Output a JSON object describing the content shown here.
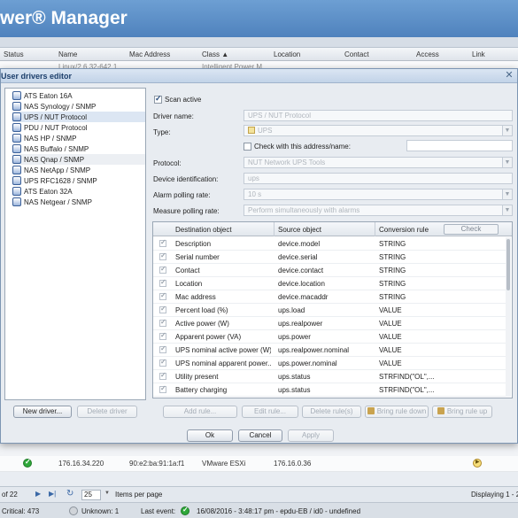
{
  "app": {
    "title": "wer® Manager"
  },
  "grid": {
    "columns": [
      "Status",
      "Name",
      "Mac Address",
      "Class ▲",
      "Location",
      "Contact",
      "Access",
      "Link"
    ],
    "top_row": {
      "name": "Linux/2.6.32-642.1",
      "class": "Intelligent Power M"
    },
    "rows": [
      {
        "ip": "176.16.34.220",
        "mac": "90:e2:ba:91:1a:f1",
        "class": "VMware ESXi",
        "location": "176.16.0.36"
      }
    ]
  },
  "pager": {
    "of_pages": "of 22",
    "page_size": "25",
    "items_label": "Items per page",
    "displaying": "Displaying 1 - 2"
  },
  "statusbar": {
    "critical": "Critical: 473",
    "unknown": "Unknown: 1",
    "last_event_label": "Last event:",
    "last_event": "16/08/2016 - 3:48:17 pm - epdu-EB / id0 - undefined"
  },
  "dialog": {
    "title": "User drivers editor",
    "drivers": [
      "ATS Eaton 16A",
      "NAS Synology / SNMP",
      "UPS / NUT Protocol",
      "PDU / NUT Protocol",
      "NAS HP / SNMP",
      "NAS Buffalo / SNMP",
      "NAS Qnap / SNMP",
      "NAS NetApp / SNMP",
      "UPS RFC1628 / SNMP",
      "ATS Eaton 32A",
      "NAS Netgear / SNMP"
    ],
    "selected_driver": "UPS / NUT Protocol",
    "form": {
      "scan_active_label": "Scan active",
      "driver_name_label": "Driver name:",
      "driver_name_value": "UPS / NUT Protocol",
      "type_label": "Type:",
      "type_value": "UPS",
      "check_address_label": "Check with this address/name:",
      "protocol_label": "Protocol:",
      "protocol_value": "NUT Network UPS Tools",
      "device_id_label": "Device identification:",
      "device_id_value": "ups",
      "alarm_label": "Alarm polling rate:",
      "alarm_value": "10 s",
      "measure_label": "Measure polling rate:",
      "measure_value": "Perform simultaneously with alarms"
    },
    "rules": {
      "headers": [
        "Destination object",
        "Source object",
        "Conversion rule"
      ],
      "check_label": "Check",
      "rows": [
        {
          "dest": "Description",
          "src": "device.model",
          "rule": "STRING"
        },
        {
          "dest": "Serial number",
          "src": "device.serial",
          "rule": "STRING"
        },
        {
          "dest": "Contact",
          "src": "device.contact",
          "rule": "STRING"
        },
        {
          "dest": "Location",
          "src": "device.location",
          "rule": "STRING"
        },
        {
          "dest": "Mac address",
          "src": "device.macaddr",
          "rule": "STRING"
        },
        {
          "dest": "Percent load (%)",
          "src": "ups.load",
          "rule": "VALUE"
        },
        {
          "dest": "Active power (W)",
          "src": "ups.realpower",
          "rule": "VALUE"
        },
        {
          "dest": "Apparent power (VA)",
          "src": "ups.power",
          "rule": "VALUE"
        },
        {
          "dest": "UPS nominal active power (W)",
          "src": "ups.realpower.nominal",
          "rule": "VALUE"
        },
        {
          "dest": "UPS nominal apparent power...",
          "src": "ups.power.nominal",
          "rule": "VALUE"
        },
        {
          "dest": "Utility present",
          "src": "ups.status",
          "rule": "STRFIND(\"OL\",..."
        },
        {
          "dest": "Battery charging",
          "src": "ups.status",
          "rule": "STRFIND(\"OL\",..."
        }
      ]
    },
    "buttons": {
      "new_driver": "New driver...",
      "delete_driver": "Delete driver",
      "add_rule": "Add rule...",
      "edit_rule": "Edit rule...",
      "delete_rules": "Delete rule(s)",
      "bring_down": "Bring rule down",
      "bring_up": "Bring rule up",
      "ok": "Ok",
      "cancel": "Cancel",
      "apply": "Apply"
    }
  }
}
